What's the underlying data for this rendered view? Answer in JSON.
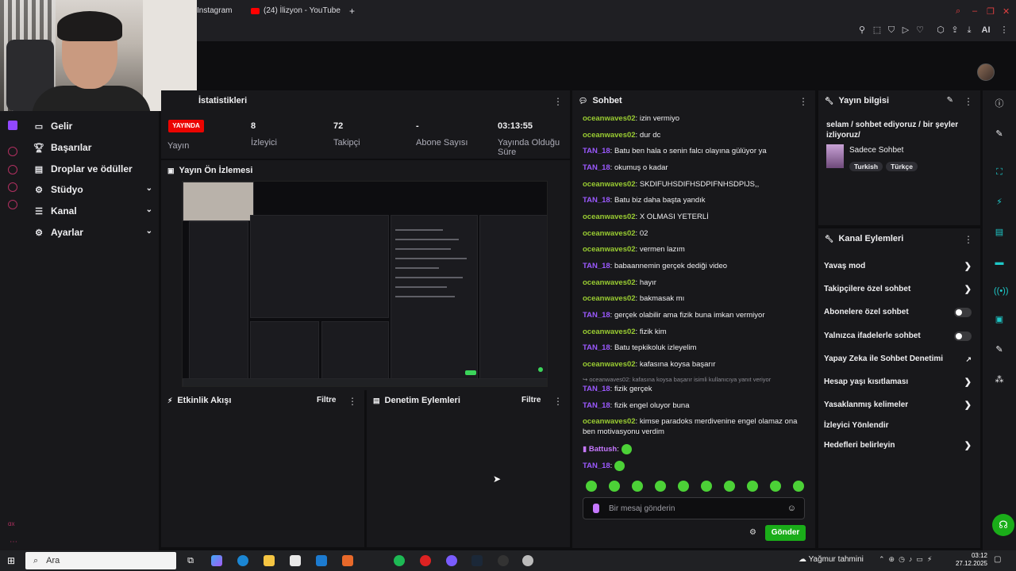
{
  "browser": {
    "tabs": [
      {
        "label": "Instagram"
      },
      {
        "label": "(24) İlizyon - YouTube"
      }
    ],
    "new_tab": "+",
    "ai_label": "AI"
  },
  "nav": {
    "items": [
      {
        "label": "Gelir"
      },
      {
        "label": "Başarılar"
      },
      {
        "label": "Droplar ve ödüller"
      },
      {
        "label": "Stüdyo"
      },
      {
        "label": "Kanal"
      },
      {
        "label": "Ayarlar"
      }
    ],
    "rail_bottom": "ɑx"
  },
  "stats": {
    "title": "İstatistikleri",
    "live_badge": "YAYINDA",
    "stream_label": "Yayın",
    "viewers_value": "8",
    "viewers_label": "İzleyici",
    "followers_value": "72",
    "followers_label": "Takipçi",
    "subs_value": "-",
    "subs_label": "Abone Sayısı",
    "uptime_value": "03:13:55",
    "uptime_label": "Yayında Olduğu Süre"
  },
  "preview": {
    "title": "Yayın Ön İzlemesi"
  },
  "activity": {
    "title": "Etkinlik Akışı",
    "filter": "Filtre"
  },
  "moderation": {
    "title": "Denetim Eylemleri",
    "filter": "Filtre"
  },
  "chat": {
    "title": "Sohbet",
    "messages": [
      {
        "user": "oceanwaves02",
        "color": "#9acd32",
        "text": "izin vermiyo"
      },
      {
        "user": "oceanwaves02",
        "color": "#9acd32",
        "text": "dur dc"
      },
      {
        "user": "TAN_18",
        "color": "#9b59ff",
        "text": "Batu ben hala o senin falcı olayına gülüyor ya"
      },
      {
        "user": "TAN_18",
        "color": "#9b59ff",
        "text": "okumuş o kadar"
      },
      {
        "user": "oceanwaves02",
        "color": "#9acd32",
        "text": "SKDIFUHSDIFHSDPIFNHSDPIJS,,"
      },
      {
        "user": "TAN_18",
        "color": "#9b59ff",
        "text": "Batu biz daha başta yandık"
      },
      {
        "user": "oceanwaves02",
        "color": "#9acd32",
        "text": "X OLMASI YETERLİ"
      },
      {
        "user": "oceanwaves02",
        "color": "#9acd32",
        "text": "02"
      },
      {
        "user": "oceanwaves02",
        "color": "#9acd32",
        "text": "vermen lazım"
      },
      {
        "user": "TAN_18",
        "color": "#9b59ff",
        "text": "babaannemin gerçek dediği video"
      },
      {
        "user": "oceanwaves02",
        "color": "#9acd32",
        "text": "hayır"
      },
      {
        "user": "oceanwaves02",
        "color": "#9acd32",
        "text": "bakmasak mı"
      },
      {
        "user": "TAN_18",
        "color": "#9b59ff",
        "text": "gerçek olabilir ama fizik buna imkan vermiyor"
      },
      {
        "user": "oceanwaves02",
        "color": "#9acd32",
        "text": "fizik kim"
      },
      {
        "user": "TAN_18",
        "color": "#9b59ff",
        "text": "Batu tepkikoluk izleyelim"
      },
      {
        "user": "oceanwaves02",
        "color": "#9acd32",
        "text": "kafasına koysa başarır"
      }
    ],
    "reply_context": "↪ oceanwaves02: kafasına koysa başarır isimli kullanıcıya yanıt veriyor",
    "messages2": [
      {
        "user": "TAN_18",
        "color": "#9b59ff",
        "text": "fizik gerçek"
      },
      {
        "user": "TAN_18",
        "color": "#9b59ff",
        "text": "fizik engel oluyor buna"
      },
      {
        "user": "oceanwaves02",
        "color": "#9acd32",
        "text": "kimse paradoks merdivenine engel olamaz ona ben motivasyonu verdim"
      },
      {
        "user": "Battush",
        "color": "#c678ff",
        "text": ""
      },
      {
        "user": "TAN_18",
        "color": "#9b59ff",
        "text": ""
      }
    ],
    "input_placeholder": "Bir mesaj gönderin",
    "send_label": "Gönder"
  },
  "stream_info": {
    "title": "Yayın bilgisi",
    "stream_title": "selam / sohbet ediyoruz / bir şeyler izliyoruz/",
    "category": "Sadece Sohbet",
    "tags": [
      "Turkish",
      "Türkçe"
    ]
  },
  "channel_actions": {
    "title": "Kanal Eylemleri",
    "items": [
      {
        "label": "Yavaş mod",
        "control": "chevron"
      },
      {
        "label": "Takipçilere özel sohbet",
        "control": "chevron"
      },
      {
        "label": "Abonelere özel sohbet",
        "control": "toggle"
      },
      {
        "label": "Yalnızca ifadelerle sohbet",
        "control": "toggle"
      },
      {
        "label": "Yapay Zeka ile Sohbet Denetimi",
        "control": "external"
      },
      {
        "label": "Hesap yaşı kısıtlaması",
        "control": "chevron"
      },
      {
        "label": "Yasaklanmış kelimeler",
        "control": "chevron"
      },
      {
        "label": "İzleyici Yönlendir",
        "control": "none"
      },
      {
        "label": "Hedefleri belirleyin",
        "control": "chevron"
      }
    ]
  },
  "taskbar": {
    "search_placeholder": "Ara",
    "weather": "Yağmur tahmini",
    "time": "03:12",
    "date": "27.12.2025"
  },
  "colors": {
    "accent_purple": "#9147ff",
    "live_red": "#eb0400",
    "send_green": "#1aad19",
    "panel_bg": "#18181b"
  }
}
